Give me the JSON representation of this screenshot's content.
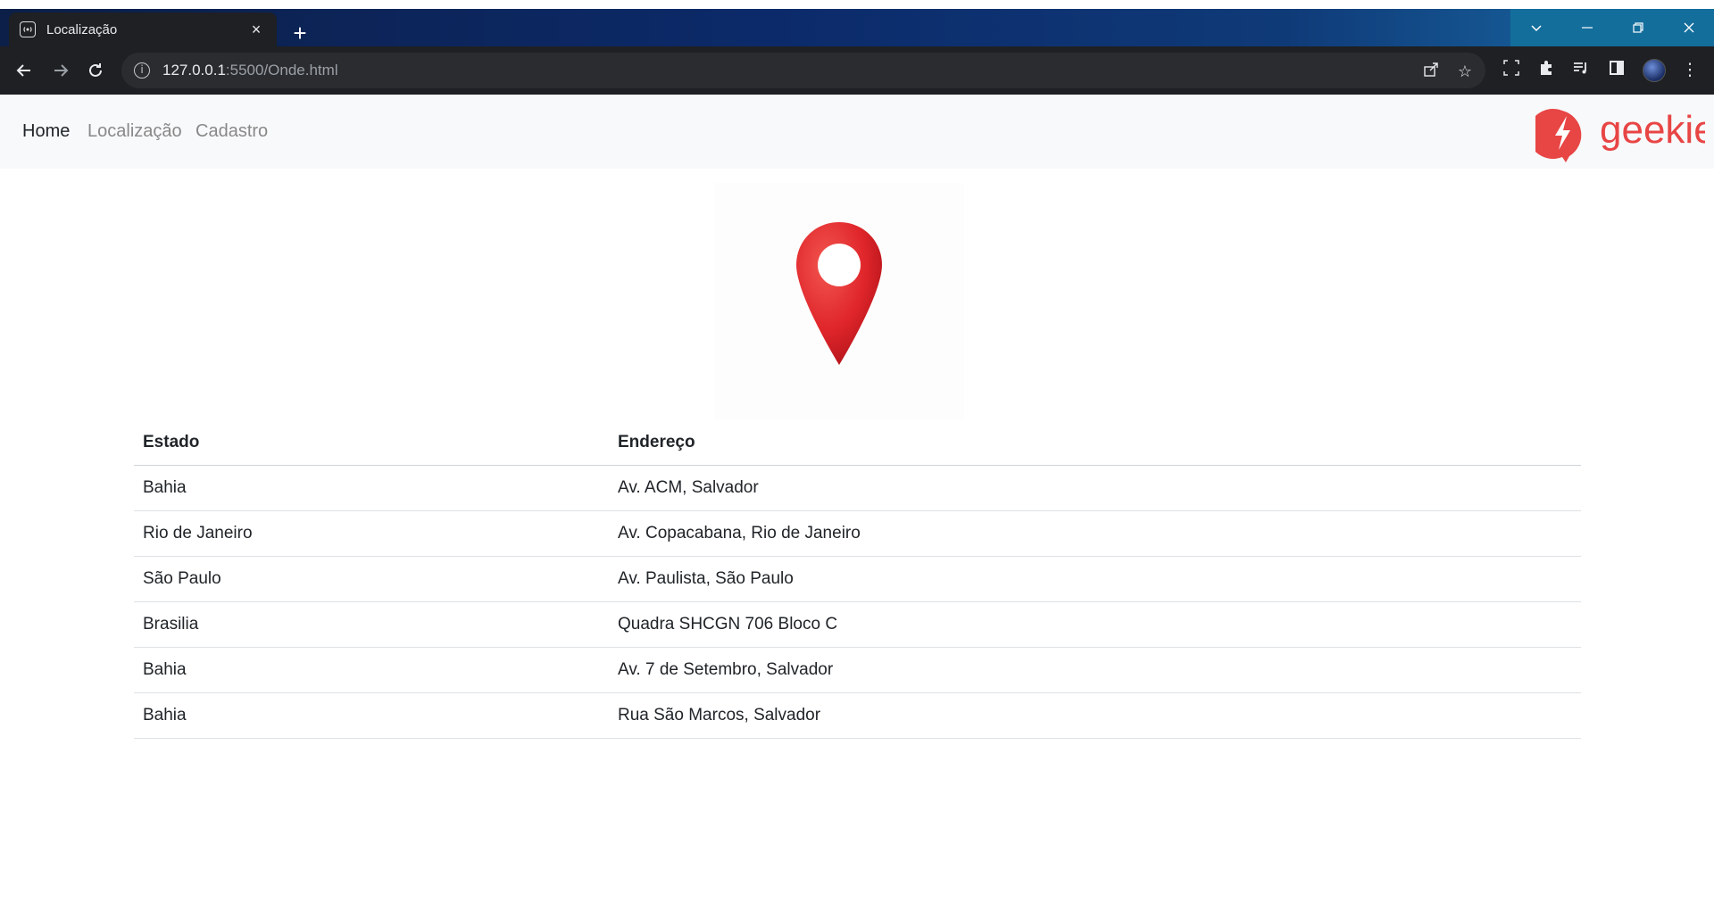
{
  "browser": {
    "tab_title": "Localização",
    "tab_close": "×",
    "new_tab": "+",
    "url_host": "127.0.0.1",
    "url_path": ":5500/Onde.html",
    "window_controls": [
      "chevron-down-icon",
      "minimize-icon",
      "restore-icon",
      "close-icon"
    ]
  },
  "navbar": {
    "links": [
      {
        "label": "Home",
        "active": true
      },
      {
        "label": "Localização",
        "active": false
      },
      {
        "label": "Cadastro",
        "active": false
      }
    ],
    "logo_text": "geekie"
  },
  "colors": {
    "brand_red": "#e84545",
    "pin_red": "#e0262b",
    "nav_bg": "#f8f9fa",
    "tab_bar_accent": "#136e9c"
  },
  "table": {
    "headers": [
      "Estado",
      "Endereço"
    ],
    "rows": [
      [
        "Bahia",
        "Av. ACM, Salvador"
      ],
      [
        "Rio de Janeiro",
        "Av. Copacabana, Rio de Janeiro"
      ],
      [
        "São Paulo",
        "Av. Paulista, São Paulo"
      ],
      [
        "Brasilia",
        "Quadra SHCGN 706 Bloco C"
      ],
      [
        "Bahia",
        "Av. 7 de Setembro, Salvador"
      ],
      [
        "Bahia",
        "Rua São Marcos, Salvador"
      ]
    ]
  }
}
